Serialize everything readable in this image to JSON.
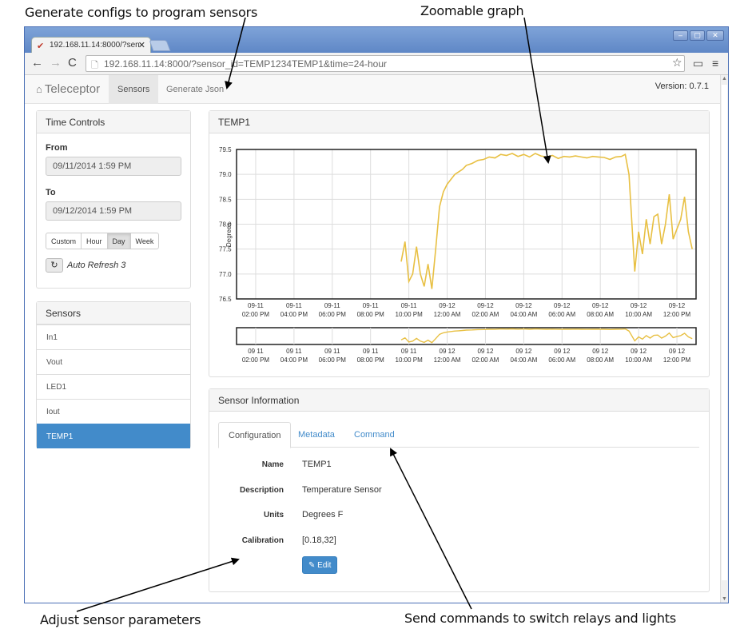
{
  "annotations": {
    "generate_configs": "Generate configs to program sensors",
    "zoomable_graph": "Zoomable graph",
    "adjust_params": "Adjust sensor parameters",
    "send_commands": "Send commands to switch relays and  lights"
  },
  "browser": {
    "tab_title": "192.168.11.14:8000/?sen",
    "url": "192.168.11.14:8000/?sensor_id=TEMP1234TEMP1&time=24-hour",
    "window_controls": [
      "minimize",
      "maximize",
      "close"
    ]
  },
  "navbar": {
    "brand": "Teleceptor",
    "links": [
      "Sensors",
      "Generate Json"
    ],
    "active_link": "Sensors",
    "version": "Version: 0.7.1"
  },
  "time_controls": {
    "heading": "Time Controls",
    "from_label": "From",
    "from_value": "09/11/2014 1:59 PM",
    "to_label": "To",
    "to_value": "09/12/2014 1:59 PM",
    "ranges": [
      "Custom",
      "Hour",
      "Day",
      "Week"
    ],
    "active_range": "Day",
    "auto_refresh_label": "Auto Refresh 3"
  },
  "sensors": {
    "heading": "Sensors",
    "items": [
      "In1",
      "Vout",
      "LED1",
      "Iout",
      "TEMP1"
    ],
    "active": "TEMP1"
  },
  "chart_panel": {
    "title": "TEMP1"
  },
  "sensor_info": {
    "heading": "Sensor Information",
    "tabs": [
      "Configuration",
      "Metadata",
      "Command"
    ],
    "active_tab": "Configuration",
    "fields": [
      {
        "label": "Name",
        "value": "TEMP1"
      },
      {
        "label": "Description",
        "value": "Temperature Sensor"
      },
      {
        "label": "Units",
        "value": "Degrees F"
      },
      {
        "label": "Calibration",
        "value": "[0.18,32]"
      }
    ],
    "edit_label": "Edit"
  },
  "colors": {
    "accent": "#428bca",
    "series": "#e8c043",
    "chrome": "#6a90cc"
  },
  "icons": [
    "home-icon",
    "refresh-icon",
    "pencil-icon",
    "star-icon",
    "cast-icon",
    "menu-icon",
    "back-icon",
    "forward-icon",
    "reload-icon",
    "page-icon"
  ],
  "chart_data": {
    "type": "line",
    "title": "TEMP1",
    "ylabel": "Degrees",
    "ylim": [
      76.5,
      79.5
    ],
    "yticks": [
      "79.5",
      "79.0",
      "78.5",
      "78.0",
      "77.5",
      "77.0",
      "76.5"
    ],
    "xlim": [
      0,
      24
    ],
    "xticks": [
      [
        "09-11",
        "02:00 PM"
      ],
      [
        "09-11",
        "04:00 PM"
      ],
      [
        "09-11",
        "06:00 PM"
      ],
      [
        "09-11",
        "08:00 PM"
      ],
      [
        "09-11",
        "10:00 PM"
      ],
      [
        "09-12",
        "12:00 AM"
      ],
      [
        "09-12",
        "02:00 AM"
      ],
      [
        "09-12",
        "04:00 AM"
      ],
      [
        "09-12",
        "06:00 AM"
      ],
      [
        "09-12",
        "08:00 AM"
      ],
      [
        "09-12",
        "10:00 AM"
      ],
      [
        "09-12",
        "12:00 PM"
      ]
    ],
    "navigator_xticks": [
      [
        "09 11",
        "02:00 PM"
      ],
      [
        "09 11",
        "04:00 PM"
      ],
      [
        "09 11",
        "06:00 PM"
      ],
      [
        "09 11",
        "08:00 PM"
      ],
      [
        "09 11",
        "10:00 PM"
      ],
      [
        "09 12",
        "12:00 AM"
      ],
      [
        "09 12",
        "02:00 AM"
      ],
      [
        "09 12",
        "04:00 AM"
      ],
      [
        "09 12",
        "06:00 AM"
      ],
      [
        "09 12",
        "08:00 AM"
      ],
      [
        "09 12",
        "10:00 AM"
      ],
      [
        "09 12",
        "12:00 PM"
      ]
    ],
    "grid": true,
    "series": [
      {
        "x": [
          8.6,
          8.8,
          9.0,
          9.2,
          9.4,
          9.6,
          9.8,
          10.0,
          10.2,
          10.4,
          10.6,
          10.8,
          11.0,
          11.2,
          11.4,
          11.6,
          11.8,
          12.0,
          12.3,
          12.6,
          12.9,
          13.2,
          13.5,
          13.8,
          14.1,
          14.4,
          14.7,
          15.0,
          15.3,
          15.6,
          15.9,
          16.2,
          16.5,
          16.8,
          17.1,
          17.4,
          17.7,
          18.0,
          18.3,
          18.6,
          18.9,
          19.2,
          19.5,
          19.8,
          20.1,
          20.3,
          20.5,
          20.8,
          21.0,
          21.2,
          21.4,
          21.6,
          21.8,
          22.0,
          22.2,
          22.4,
          22.6,
          22.8,
          23.0,
          23.2,
          23.4,
          23.6,
          23.8
        ],
        "y": [
          77.25,
          77.65,
          76.85,
          77.0,
          77.55,
          77.0,
          76.75,
          77.2,
          76.7,
          77.5,
          78.35,
          78.65,
          78.8,
          78.9,
          79.0,
          79.05,
          79.1,
          79.18,
          79.22,
          79.28,
          79.3,
          79.35,
          79.33,
          79.4,
          79.38,
          79.42,
          79.36,
          79.4,
          79.35,
          79.42,
          79.37,
          79.35,
          79.38,
          79.32,
          79.36,
          79.35,
          79.37,
          79.35,
          79.33,
          79.36,
          79.35,
          79.34,
          79.3,
          79.35,
          79.36,
          79.4,
          79.0,
          77.05,
          77.85,
          77.4,
          78.1,
          77.6,
          78.15,
          78.2,
          77.6,
          78.0,
          78.6,
          77.7,
          77.9,
          78.1,
          78.55,
          77.85,
          77.5
        ]
      }
    ]
  }
}
